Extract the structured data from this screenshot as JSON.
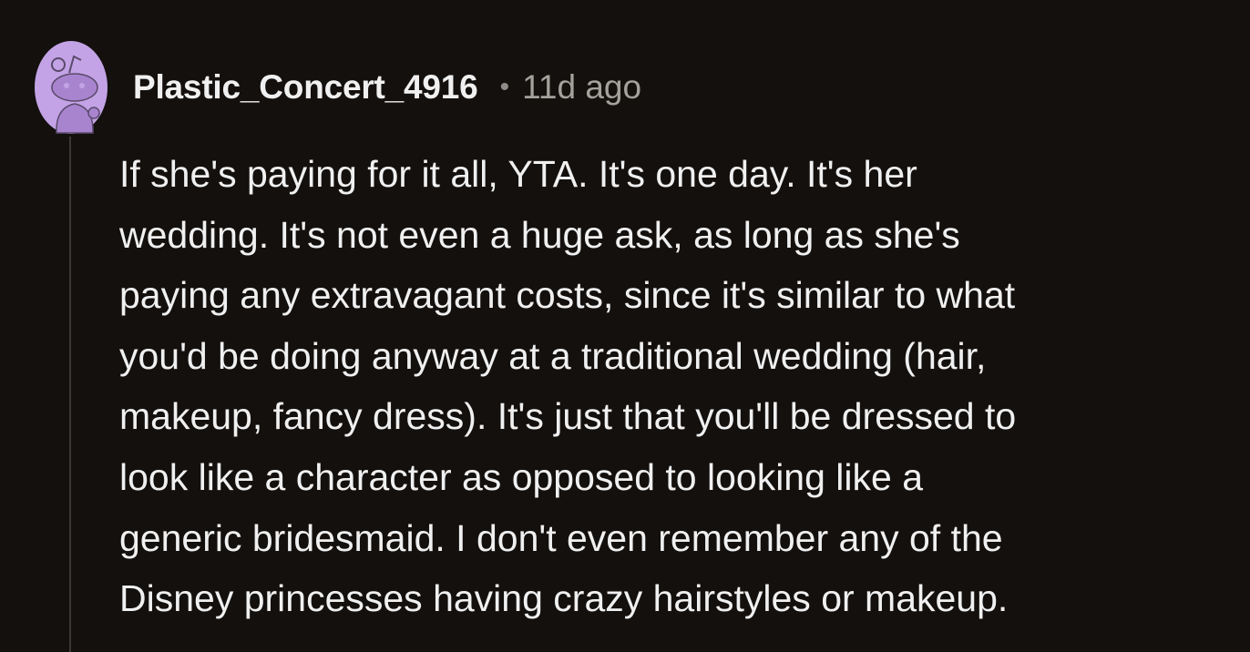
{
  "comment": {
    "author": "Plastic_Concert_4916",
    "separator": "•",
    "timestamp": "11d ago",
    "avatar_icon": "reddit-snoo-avatar",
    "colors": {
      "background": "#13100e",
      "avatar_background": "#c3a3e6",
      "text": "#f0f0f0",
      "meta": "#a5a19c"
    },
    "body_lines": [
      "If she's paying for it all, YTA. It's one day. It's her",
      "wedding. It's not even a huge ask, as long as she's",
      "paying any extravagant costs, since it's similar to what",
      "you'd be doing anyway at a traditional wedding (hair,",
      "makeup, fancy dress). It's just that you'll be dressed to",
      "look like a character as opposed to looking like a",
      "generic bridesmaid. I don't even remember any of the",
      "Disney princesses having crazy hairstyles or makeup."
    ]
  }
}
